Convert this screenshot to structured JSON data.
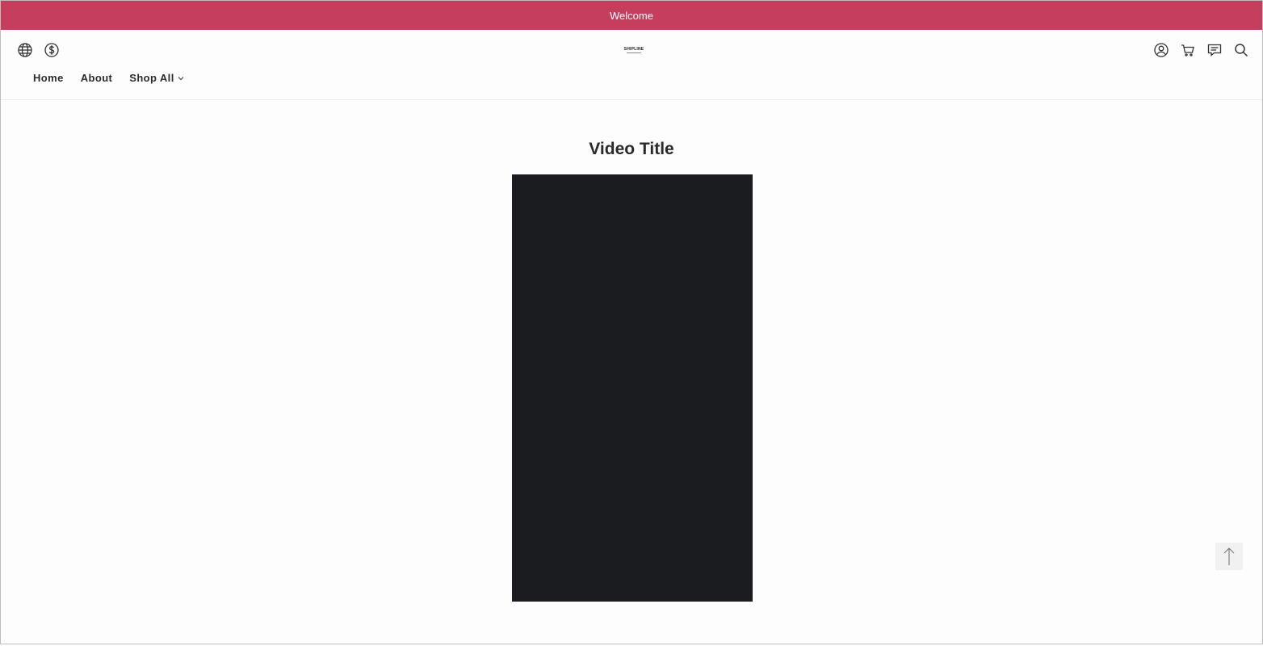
{
  "announcement": {
    "text": "Welcome",
    "bg_color": "#c63e5e"
  },
  "header": {
    "left_icons": [
      "globe-icon",
      "dollar-icon"
    ],
    "right_icons": [
      "user-icon",
      "cart-icon",
      "chat-icon",
      "search-icon"
    ],
    "logo": {
      "text": "SHIPLINE"
    }
  },
  "nav": {
    "items": [
      {
        "label": "Home"
      },
      {
        "label": "About"
      },
      {
        "label": "Shop All",
        "has_dropdown": true
      }
    ]
  },
  "main": {
    "title": "Video Title"
  }
}
